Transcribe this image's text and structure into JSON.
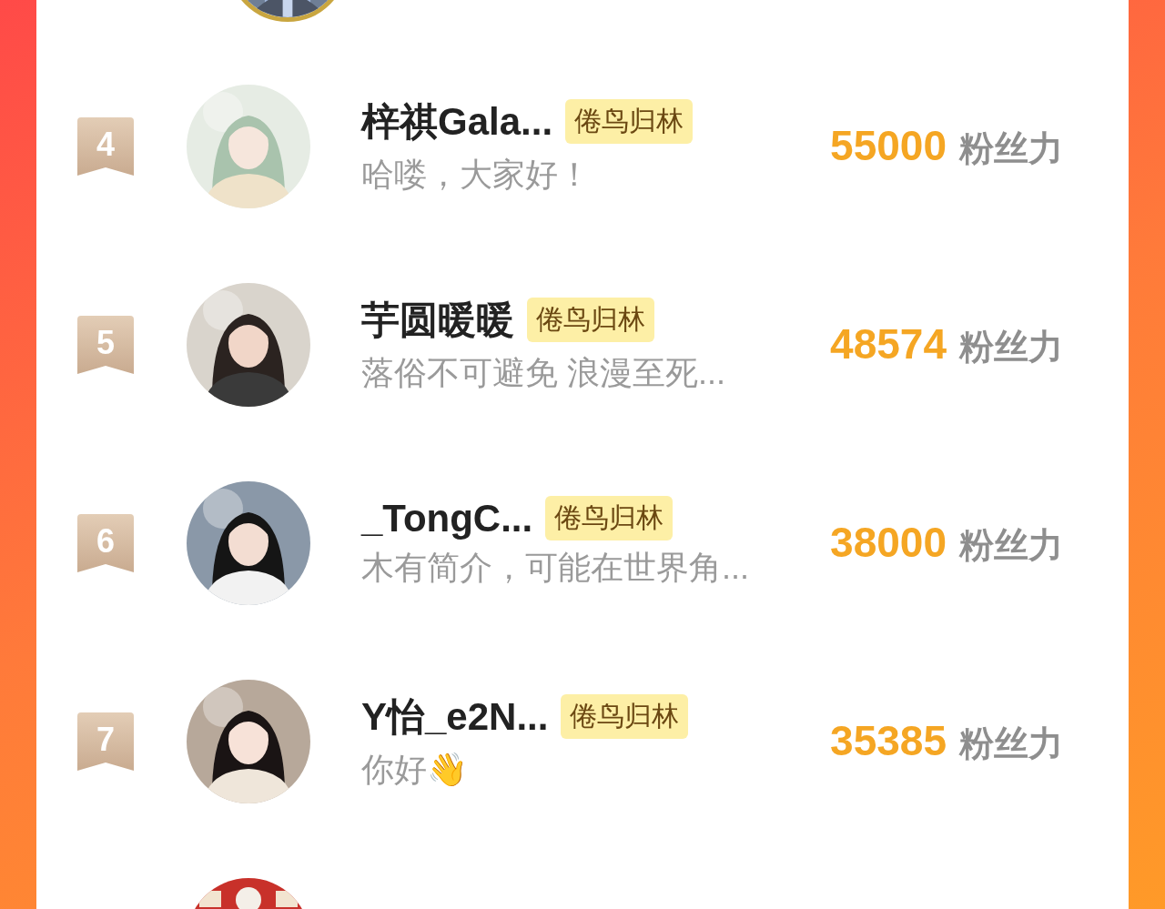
{
  "rows": [
    {
      "rank": "4",
      "name": "梓祺Gala...",
      "badge": "倦鸟归林",
      "bio": "哈喽，大家好！",
      "score": "55000",
      "unit": "粉丝力"
    },
    {
      "rank": "5",
      "name": "芋圆暖暖",
      "badge": "倦鸟归林",
      "bio": "落俗不可避免 浪漫至死...",
      "score": "48574",
      "unit": "粉丝力"
    },
    {
      "rank": "6",
      "name": "_TongC...",
      "badge": "倦鸟归林",
      "bio": "木有简介，可能在世界角...",
      "score": "38000",
      "unit": "粉丝力"
    },
    {
      "rank": "7",
      "name": "Y怡_e2N...",
      "badge": "倦鸟归林",
      "bio": "你好👋",
      "score": "35385",
      "unit": "粉丝力"
    }
  ]
}
